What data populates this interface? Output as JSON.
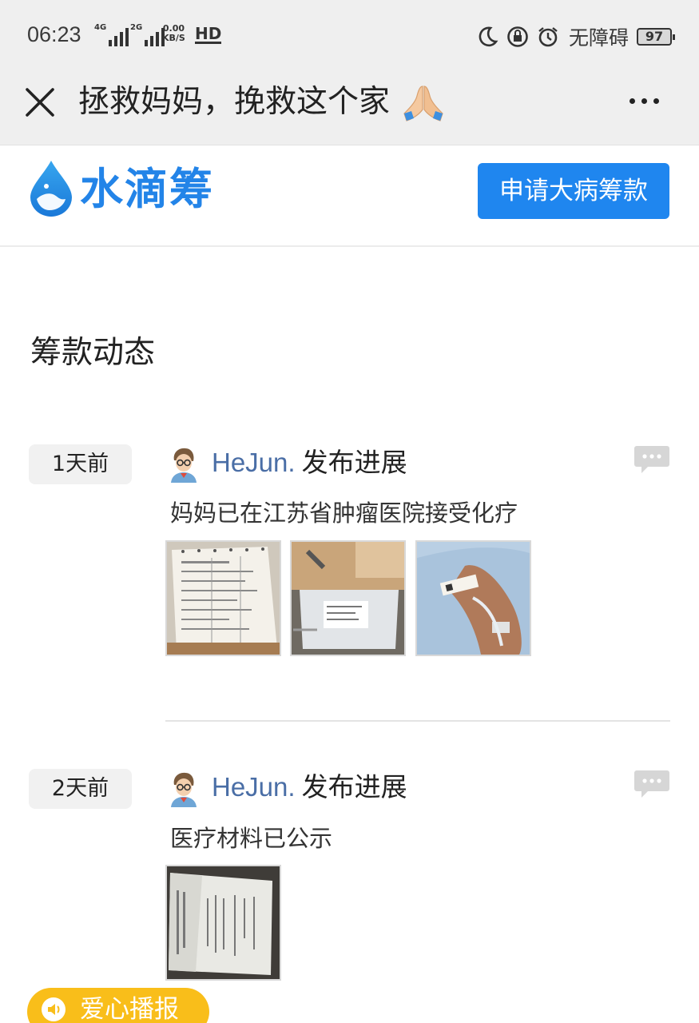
{
  "status_bar": {
    "time": "06:23",
    "net1_label": "4G",
    "net2_label": "2G",
    "speed_value": "0.00",
    "speed_unit": "KB/S",
    "hd_label": "HD",
    "accessibility": "无障碍",
    "battery": "97"
  },
  "title_bar": {
    "title": "拯救妈妈，挽救这个家",
    "title_icon": "folded-hands-emoji",
    "close_icon": "close-icon",
    "more_icon": "more-icon"
  },
  "brand": {
    "name": "水滴筹",
    "apply_button": "申请大病筹款",
    "colors": {
      "brand_blue": "#2384e8",
      "button_blue": "#1f86ef"
    }
  },
  "section": {
    "title": "筹款动态"
  },
  "posts": [
    {
      "time": "1天前",
      "author": "HeJun.",
      "action": "发布进展",
      "text": "妈妈已在江苏省肿瘤医院接受化疗",
      "images": [
        "medical-document-photo",
        "iv-bag-photo",
        "patient-arm-iv-photo"
      ]
    },
    {
      "time": "2天前",
      "author": "HeJun.",
      "action": "发布进展",
      "text": "医疗材料已公示",
      "images": [
        "medical-report-photo"
      ]
    }
  ],
  "floating": {
    "label": "爱心播报",
    "color": "#f9be1a"
  }
}
